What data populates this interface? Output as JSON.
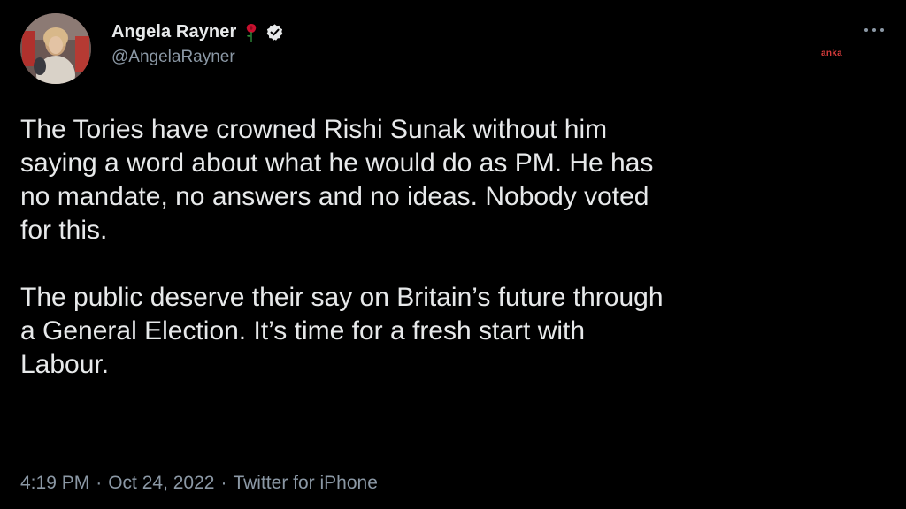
{
  "author": {
    "display_name": "Angela Rayner",
    "handle": "@AngelaRayner",
    "badges": [
      "rose-icon",
      "verified-icon"
    ]
  },
  "watermark": "anka",
  "tweet": {
    "paragraphs": [
      "The Tories have crowned Rishi Sunak without him\nsaying a word about what he would do as PM. He has\nno mandate, no answers and no ideas. Nobody voted\nfor this.",
      "The public deserve their say on Britain’s future through\na General Election. It’s time for a fresh start with\nLabour."
    ]
  },
  "meta": {
    "time": "4:19 PM",
    "separator": "·",
    "date": "Oct 24, 2022",
    "source": "Twitter for iPhone"
  },
  "colors": {
    "background": "#000000",
    "text": "#e7e9ea",
    "secondary": "#8b98a5",
    "rose": "#c8102e",
    "watermark": "#d63b3b"
  }
}
